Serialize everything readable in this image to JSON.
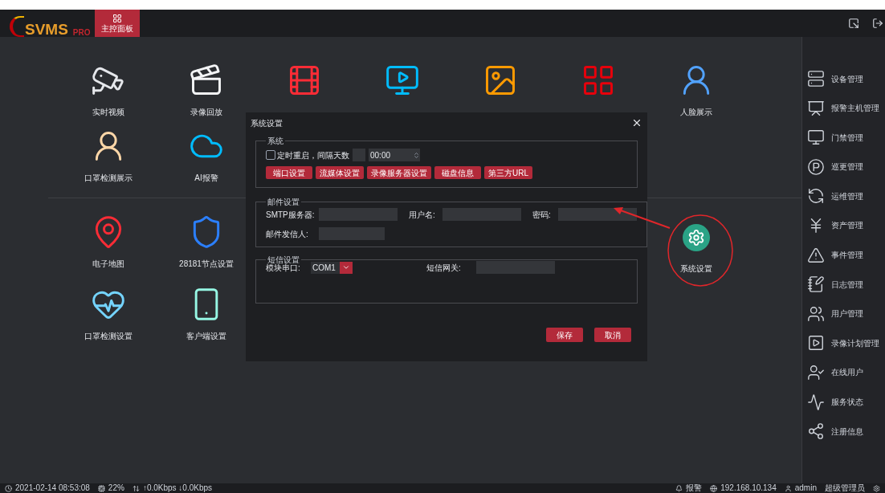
{
  "header": {
    "logo": "SVMS",
    "logo_suffix": "PRO",
    "tabs": [
      {
        "label": "主控面板",
        "selected": true
      }
    ]
  },
  "tiles_top": [
    {
      "label": "实时视频",
      "kind": "camera"
    },
    {
      "label": "录像回放",
      "kind": "clapper"
    },
    {
      "kind": "film"
    },
    {
      "kind": "player"
    },
    {
      "kind": "photo"
    },
    {
      "kind": "matrix"
    },
    {
      "label": "人脸展示",
      "kind": "face"
    },
    {
      "label": "口罩检测展示",
      "kind": "person"
    },
    {
      "label": "AI报警",
      "kind": "cloud"
    }
  ],
  "tiles_bottom": [
    {
      "label": "电子地图",
      "kind": "map"
    },
    {
      "label": "28181节点设置",
      "kind": "shield"
    },
    {
      "label": "系统设置",
      "kind": "gear"
    },
    {
      "label": "口罩检测设置",
      "kind": "mask"
    },
    {
      "label": "客户端设置",
      "kind": "phone"
    }
  ],
  "sidebar": {
    "items": [
      {
        "label": "设备管理",
        "kind": "server"
      },
      {
        "label": "报警主机管理",
        "kind": "chart"
      },
      {
        "label": "门禁管理",
        "kind": "door"
      },
      {
        "label": "巡更管理",
        "kind": "parking"
      },
      {
        "label": "运维管理",
        "kind": "cycle"
      },
      {
        "label": "资产管理",
        "kind": "yen"
      },
      {
        "label": "事件管理",
        "kind": "warning"
      },
      {
        "label": "日志管理",
        "kind": "note"
      },
      {
        "label": "用户管理",
        "kind": "users"
      },
      {
        "label": "录像计划管理",
        "kind": "video"
      },
      {
        "label": "在线用户",
        "kind": "online"
      },
      {
        "label": "服务状态",
        "kind": "pulse"
      },
      {
        "label": "注册信息",
        "kind": "share"
      }
    ]
  },
  "dialog": {
    "title": "系统设置",
    "system": {
      "title": "系统",
      "restart": {
        "label": "定时重启，间隔天数",
        "checked": false,
        "time": "00:00"
      },
      "buttons": [
        "端口设置",
        "流媒体设置",
        "录像服务器设置",
        "磁盘信息",
        "第三方URL"
      ]
    },
    "mail": {
      "title": "邮件设置",
      "fields": [
        {
          "label": "SMTP服务器:"
        },
        {
          "label": "用户名:"
        },
        {
          "label": "密码:"
        },
        {
          "label": "邮件发信人:"
        }
      ]
    },
    "sms": {
      "title": "短信设置",
      "port": {
        "label": "模块串口:",
        "value": "COM1"
      },
      "gateway": {
        "label": "短信网关:"
      }
    },
    "actions": [
      "保存",
      "取消"
    ]
  },
  "status_bar": {
    "time": "2021-02-14 08:53:08",
    "cpu": "22%",
    "network": "↑0.0Kbps ↓0.0Kbps",
    "alarm": "报警",
    "ip": "192.168.10.134",
    "user": "admin",
    "role": "超级管理员"
  }
}
